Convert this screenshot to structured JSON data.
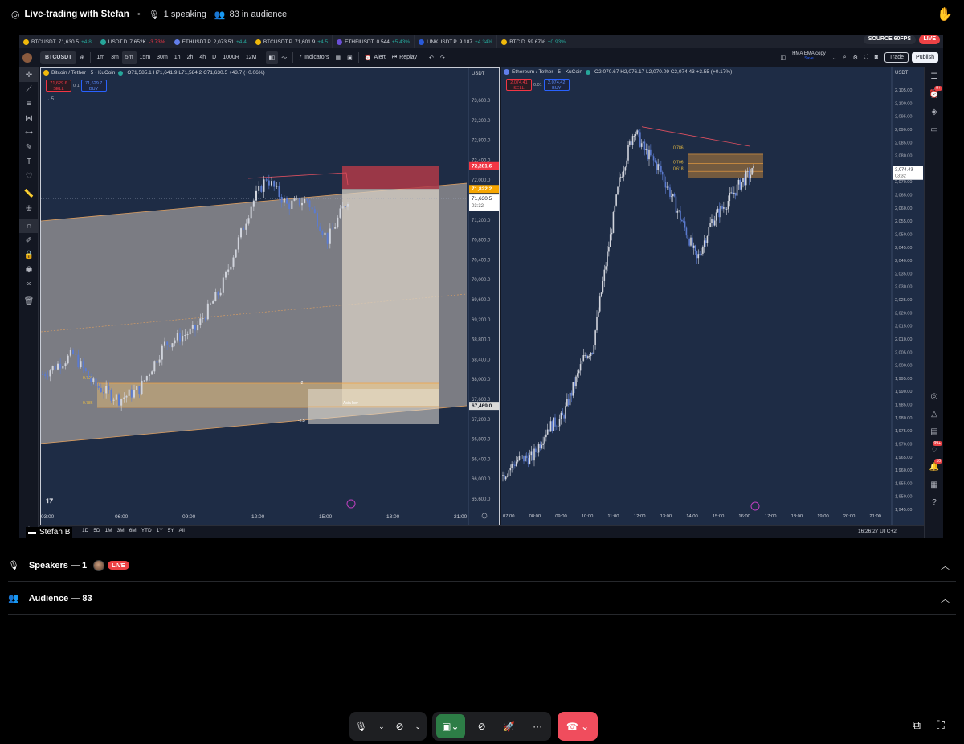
{
  "stage": {
    "title": "Live-trading with Stefan",
    "speaking": "1 speaking",
    "audience": "83 in audience"
  },
  "stream": {
    "source_badge": "SOURCE 60FPS",
    "live_badge": "LIVE",
    "streamer_name": "Stefan B"
  },
  "tickers": [
    {
      "symbol": "BTCUSDT",
      "price": "71,630.5",
      "change": "+4.8",
      "color": "#f0b90b",
      "change_color": "#26a69a"
    },
    {
      "symbol": "USDT.D",
      "price": "7.652K",
      "change": "-3.73%",
      "color": "#26a69a",
      "change_color": "#f23645"
    },
    {
      "symbol": "ETHUSDT.P",
      "price": "2,073.51",
      "change": "+4.4",
      "color": "#627eea",
      "change_color": "#26a69a"
    },
    {
      "symbol": "BTCUSDT.P",
      "price": "71,601.9",
      "change": "+4.5",
      "color": "#f0b90b",
      "change_color": "#26a69a"
    },
    {
      "symbol": "ETHFIUSDT",
      "price": "0.544",
      "change": "+5.43%",
      "color": "#6b4fd8",
      "change_color": "#26a69a"
    },
    {
      "symbol": "LINKUSDT.P",
      "price": "9.187",
      "change": "+4.34%",
      "color": "#2a5ada",
      "change_color": "#26a69a"
    },
    {
      "symbol": "BTC.D",
      "price": "59.67%",
      "change": "+0.93%",
      "color": "#f0b90b",
      "change_color": "#26a69a"
    }
  ],
  "toolbar": {
    "symbol": "BTCUSDT",
    "timeframes": [
      "1m",
      "3m",
      "5m",
      "15m",
      "30m",
      "1h",
      "2h",
      "4h",
      "D",
      "1000R",
      "12M"
    ],
    "active_timeframe": "5m",
    "indicators": "Indicators",
    "alert": "Alert",
    "replay": "Replay",
    "layout_name": "HMA EMA copy",
    "layout_sub": "Save",
    "trade": "Trade",
    "publish": "Publish"
  },
  "pane1": {
    "title": "Bitcoin / Tether · 5 · KuCoin",
    "ohlc": "O71,585.1 H71,641.9 L71,584.2 C71,630.5 +43.7 (+0.06%)",
    "sell_price": "71,629.6",
    "sell_label": "SELL",
    "spread": "0.1",
    "buy_price": "71,629.7",
    "buy_label": "BUY",
    "interval": "5",
    "currency": "USDT",
    "price_ticks": [
      "73,600.0",
      "73,200.0",
      "72,800.0",
      "72,400.0",
      "72,000.0",
      "71,600.0",
      "71,200.0",
      "70,800.0",
      "70,400.0",
      "70,000.0",
      "69,600.0",
      "69,200.0",
      "68,800.0",
      "68,400.0",
      "68,000.0",
      "67,600.0",
      "67,200.0",
      "66,800.0",
      "66,400.0",
      "66,000.0",
      "65,600.0"
    ],
    "time_ticks": [
      "03:00",
      "06:00",
      "09:00",
      "12:00",
      "15:00",
      "18:00",
      "21:00"
    ],
    "label_stop": "72,281.6",
    "label_entry": "71,822.2",
    "label_last": "71,630.5",
    "label_countdown": "03:32",
    "label_bottom": "67,469.0",
    "fib_706": "0.706",
    "fib_786": "0.786",
    "fib_neg2": "-2",
    "fib_neg25": "-2.5",
    "asia_low": "Asia low"
  },
  "pane2": {
    "title": "Ethereum / Tether · 5 · KuCoin",
    "ohlc": "O2,070.67 H2,076.17 L2,070.09 C2,074.43 +3.55 (+0.17%)",
    "sell_price": "2,074.41",
    "sell_label": "SELL",
    "spread": "0.01",
    "buy_price": "2,074.42",
    "buy_label": "BUY",
    "currency": "USDT",
    "price_ticks": [
      "2,105.00",
      "2,100.00",
      "2,095.00",
      "2,090.00",
      "2,085.00",
      "2,080.00",
      "2,075.00",
      "2,070.00",
      "2,065.00",
      "2,060.00",
      "2,055.00",
      "2,050.00",
      "2,045.00",
      "2,040.00",
      "2,035.00",
      "2,030.00",
      "2,025.00",
      "2,020.00",
      "2,015.00",
      "2,010.00",
      "2,005.00",
      "2,000.00",
      "1,995.00",
      "1,990.00",
      "1,985.00",
      "1,980.00",
      "1,975.00",
      "1,970.00",
      "1,965.00",
      "1,960.00",
      "1,955.00",
      "1,950.00",
      "1,945.00"
    ],
    "time_ticks": [
      "07:00",
      "08:00",
      "09:00",
      "10:00",
      "11:00",
      "12:00",
      "13:00",
      "14:00",
      "15:00",
      "16:00",
      "17:00",
      "18:00",
      "19:00",
      "20:00",
      "21:00"
    ],
    "label_last": "2,074.43",
    "label_countdown": "03:32",
    "fib_786": "0.786",
    "fib_706": "0.706",
    "fib_618": "0.618"
  },
  "footer": {
    "ranges": [
      "1D",
      "5D",
      "1M",
      "3M",
      "6M",
      "YTD",
      "1Y",
      "5Y",
      "All"
    ],
    "clock": "16:26:27 UTC+2"
  },
  "sections": {
    "speakers": "Speakers — 1",
    "speaker_live": "LIVE",
    "audience": "Audience — 83"
  },
  "colors": {
    "bull": "#d1d4dc",
    "bear": "#5b7bd0",
    "accent_live": "#ed4245",
    "pane_bg": "#1e2c45",
    "end_call": "#f04d5d",
    "screen_share": "#2d7d46"
  },
  "icons": [
    "stage-icon",
    "mic-icon",
    "audience-icon",
    "raise-hand-icon",
    "crosshair-icon",
    "trendline-icon",
    "fib-icon",
    "pattern-icon",
    "forecast-icon",
    "brush-icon",
    "text-icon",
    "heart-icon",
    "ruler-icon",
    "zoom-icon",
    "magnet-icon",
    "lock-icon",
    "eye-icon",
    "link-icon",
    "trash-icon",
    "star-icon",
    "camera-off-icon",
    "screen-share-icon",
    "activity-icon",
    "more-icon",
    "leave-call-icon",
    "popout-icon",
    "fullscreen-icon"
  ]
}
